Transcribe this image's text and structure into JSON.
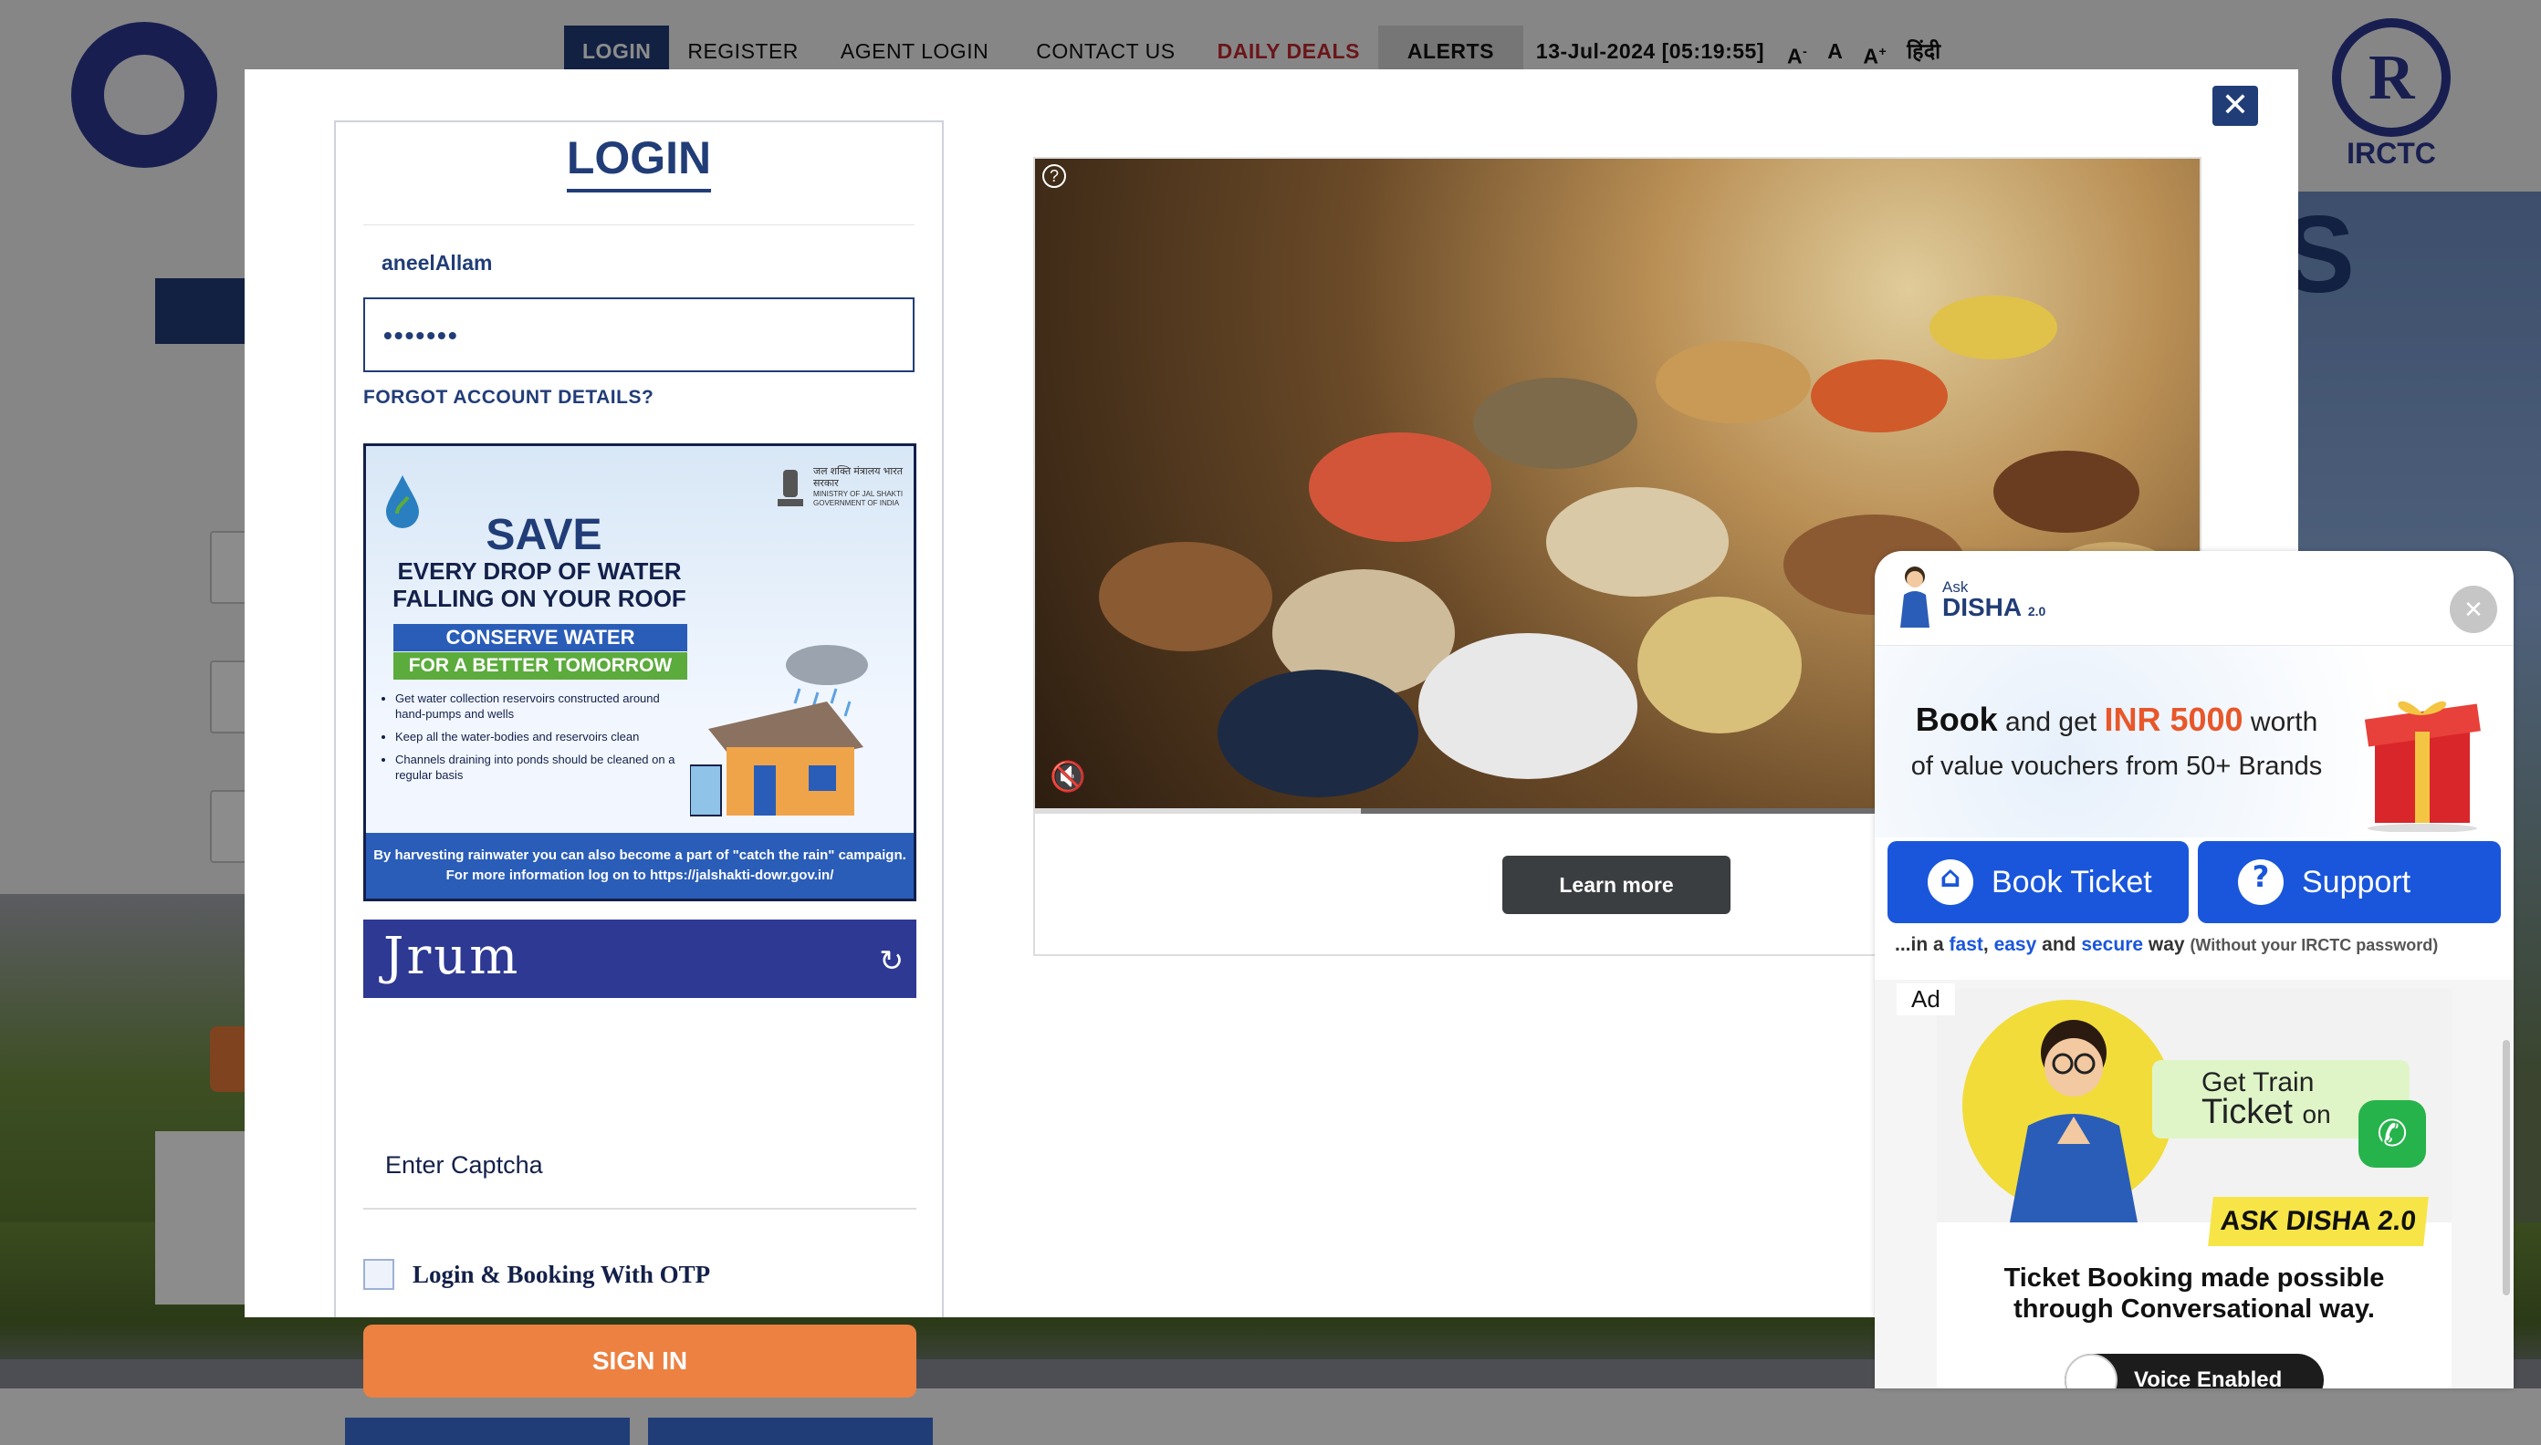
{
  "nav": {
    "items": [
      "LOGIN",
      "REGISTER",
      "AGENT LOGIN",
      "CONTACT US",
      "DAILY DEALS",
      "ALERTS"
    ],
    "datetime": "13-Jul-2024 [05:19:55]",
    "font_small": "A",
    "font_small_sup": "-",
    "font_normal": "A",
    "font_large": "A",
    "font_large_sup": "+",
    "hindi": "हिंदी"
  },
  "logos": {
    "irctc": "IRCTC"
  },
  "login": {
    "title": "LOGIN",
    "username_value": "aneelAllam",
    "password_value": "•••••••",
    "forgot_link": "FORGOT ACCOUNT DETAILS?",
    "captcha_image_text": "Jrum",
    "captcha_placeholder": "Enter Captcha",
    "otp_label": "Login & Booking With OTP",
    "signin_label": "SIGN IN"
  },
  "poster": {
    "ministry_hi": "जल शक्ति मंत्रालय भारत सरकार",
    "ministry_en": "MINISTRY OF JAL SHAKTI GOVERNMENT OF INDIA",
    "save": "SAVE",
    "subtitle_1": "EVERY DROP OF WATER",
    "subtitle_2": "FALLING ON YOUR ROOF",
    "conserve_1": "CONSERVE WATER",
    "conserve_2": "FOR A BETTER TOMORROW",
    "bullets": [
      "Get water collection reservoirs constructed around hand-pumps and wells",
      "Keep all the water-bodies and reservoirs clean",
      "Channels draining into ponds should be cleaned on a regular basis"
    ],
    "footer_1": "By harvesting rainwater you can also become a part of \"catch the rain\" campaign.",
    "footer_2": "For more information log on to https://jalshakti-dowr.gov.in/"
  },
  "video_ad": {
    "info_icon": "?",
    "progress_fraction": 0.28,
    "learn_more": "Learn more"
  },
  "disha": {
    "ask": "Ask",
    "name": "DISHA",
    "version": "2.0",
    "promo_book": "Book",
    "promo_and_get": "and get",
    "promo_amount": "INR 5000",
    "promo_worth": "worth",
    "promo_line2": "of value vouchers from 50+ Brands",
    "book_ticket": "Book Ticket",
    "support": "Support",
    "tagline_prefix": "...in a",
    "tagline_fast": "fast",
    "tagline_comma": ",",
    "tagline_easy": "easy",
    "tagline_and": "and",
    "tagline_secure": "secure",
    "tagline_way": "way",
    "tagline_note": "(Without your IRCTC password)",
    "ad_label": "Ad",
    "ad_get_train": "Get Train",
    "ad_ticket": "Ticket",
    "ad_on": "on",
    "ad_ask_disha": "ASK DISHA 2.0",
    "ad_desc_1": "Ticket Booking made possible",
    "ad_desc_2": "through Conversational way.",
    "voice": "Voice Enabled"
  },
  "colors": {
    "navy": "#213d77",
    "orange": "#ec8142",
    "deals_red": "#c1272d",
    "disha_blue": "#1a56db"
  }
}
